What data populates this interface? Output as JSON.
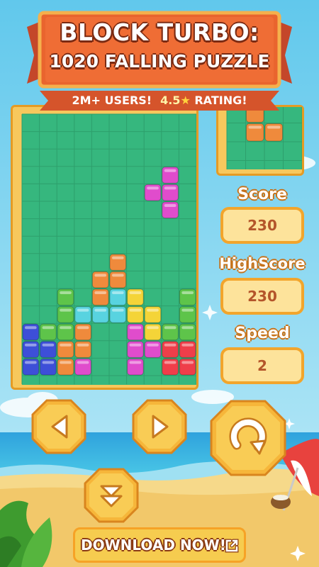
{
  "title_line1": "BLOCK TURBO:",
  "title_line2": "1020 FALLING PUZZLE",
  "tagline": {
    "users": "2M+ USERS!",
    "rating_value": "4.5",
    "rating_label": "RATING!"
  },
  "score": {
    "label": "Score",
    "value": "230"
  },
  "highscore": {
    "label": "HighScore",
    "value": "230"
  },
  "speed": {
    "label": "Speed",
    "value": "2"
  },
  "download": {
    "label": "DOWNLOAD NOW!"
  },
  "colors": {
    "green": "#5ec44a",
    "cyan": "#58d3e0",
    "yellow": "#f4d438",
    "magenta": "#e34ad9",
    "purple": "#e04ccc",
    "orange": "#ef8a3c",
    "blue": "#3d4fd8",
    "red": "#ef3e4a",
    "board_bg": "#36b77e",
    "frame": "#f7c85d"
  },
  "icons": [
    "star-icon",
    "arrow-left-icon",
    "arrow-right-icon",
    "arrow-down-icon",
    "rotate-icon",
    "external-link-icon"
  ]
}
